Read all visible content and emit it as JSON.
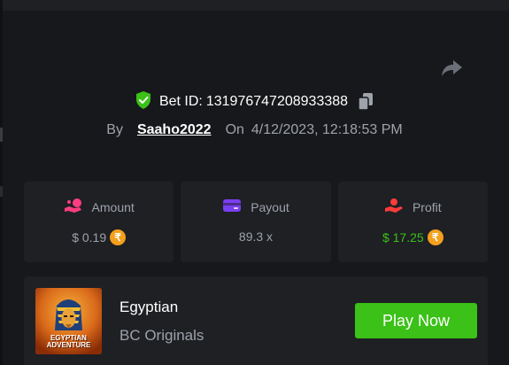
{
  "bet": {
    "id_label": "Bet ID:",
    "id_value": "131976747208933388",
    "by_label": "By",
    "username": "Saaho2022",
    "on_label": "On",
    "timestamp": "4/12/2023, 12:18:53 PM"
  },
  "icons": {
    "verified": "shield-check-icon",
    "copy": "copy-icon",
    "share": "share-arrow-icon",
    "amount": "coins-hand-icon",
    "payout": "wallet-icon",
    "profit": "hand-coin-icon",
    "currency": "rupee-coin-icon"
  },
  "stats": {
    "amount": {
      "label": "Amount",
      "value": "$ 0.19",
      "currency_symbol": "₹"
    },
    "payout": {
      "label": "Payout",
      "value": "89.3 x"
    },
    "profit": {
      "label": "Profit",
      "value": "$ 17.25",
      "currency_symbol": "₹"
    }
  },
  "game": {
    "name": "Egyptian",
    "provider": "BC Originals",
    "thumb_line1": "EGYPTIAN",
    "thumb_line2": "ADVENTURE",
    "play_label": "Play Now"
  },
  "colors": {
    "background": "#17181b",
    "card": "#1e2024",
    "accent_green": "#3bc117",
    "muted_text": "#9ea2aa",
    "amount_icon": "#ff3d7f",
    "payout_icon": "#7b3ff2",
    "profit_icon": "#ff3b3b",
    "rupee_coin": "#f4a01c"
  }
}
